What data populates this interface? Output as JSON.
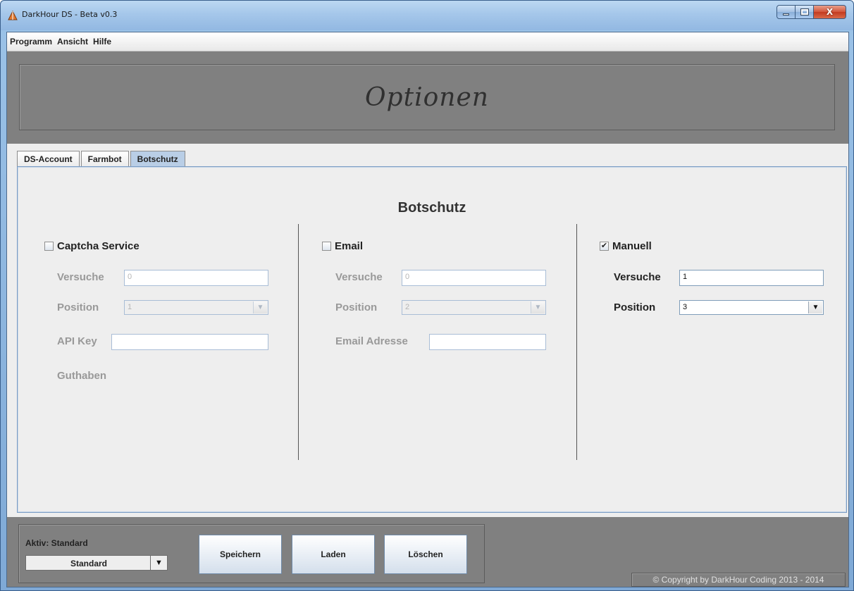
{
  "window": {
    "title": "DarkHour DS - Beta v0.3",
    "icons": {
      "app": "app-logo-icon",
      "minimize": "minimize-icon",
      "maximize": "maximize-icon",
      "close": "close-icon"
    },
    "close_glyph": "X"
  },
  "menu": {
    "items": [
      "Programm",
      "Ansicht",
      "Hilfe"
    ]
  },
  "banner": {
    "title": "Optionen"
  },
  "tabs": {
    "items": [
      "DS-Account",
      "Farmbot",
      "Botschutz"
    ],
    "selected": "Botschutz"
  },
  "panel": {
    "title": "Botschutz",
    "captcha": {
      "checkbox_label": "Captcha Service",
      "checked": false,
      "versuche_label": "Versuche",
      "versuche_value": "0",
      "position_label": "Position",
      "position_value": "1",
      "api_key_label": "API Key",
      "api_key_value": "",
      "guthaben_label": "Guthaben"
    },
    "email": {
      "checkbox_label": "Email",
      "checked": false,
      "versuche_label": "Versuche",
      "versuche_value": "0",
      "position_label": "Position",
      "position_value": "2",
      "address_label": "Email Adresse",
      "address_value": ""
    },
    "manuell": {
      "checkbox_label": "Manuell",
      "checked": true,
      "check_glyph": "✔",
      "versuche_label": "Versuche",
      "versuche_value": "1",
      "position_label": "Position",
      "position_value": "3"
    },
    "combo_arrow_glyph": "▼"
  },
  "bottom": {
    "aktiv_label": "Aktiv:  Standard",
    "profile_value": "Standard",
    "buttons": {
      "save": "Speichern",
      "load": "Laden",
      "delete": "Löschen"
    },
    "copyright": "© Copyright by DarkHour Coding 2013 - 2014"
  },
  "colors": {
    "client_bg": "#808080",
    "panel_bg": "#eeeeee",
    "selected_tab": "#b9cee6",
    "disabled_text": "#999999"
  }
}
